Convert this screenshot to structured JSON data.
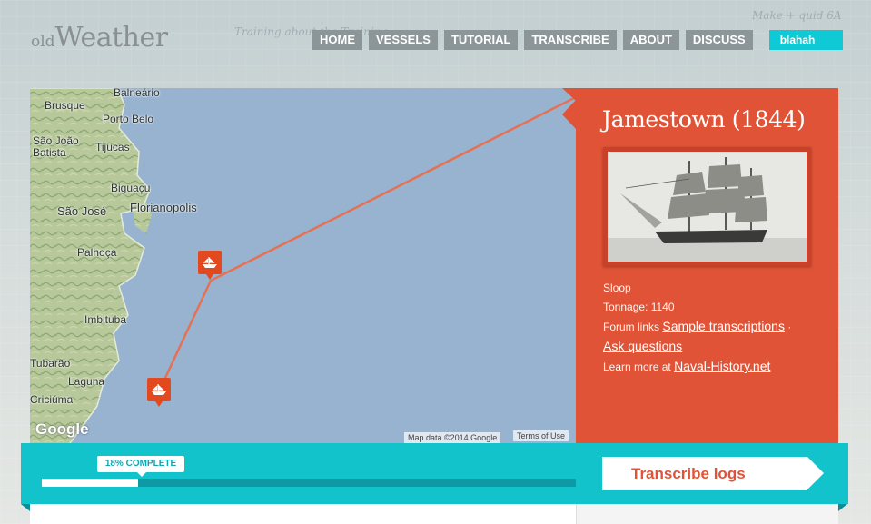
{
  "header": {
    "logo_small": "old",
    "logo_big": "Weather",
    "nav": [
      "HOME",
      "VESSELS",
      "TUTORIAL",
      "TRANSCRIBE",
      "ABOUT",
      "DISCUSS"
    ],
    "user": "blahah"
  },
  "map": {
    "labels": [
      "Balneário",
      "Brusque",
      "Porto Belo",
      "São João Batista",
      "Tijucas",
      "Biguaçu",
      "São José",
      "Florianopolis",
      "Palhoça",
      "Imbituba",
      "Tubarão",
      "Laguna",
      "Criciúma"
    ],
    "logo": "Google",
    "attribution": "Map data ©2014 Google",
    "terms": "Terms of Use"
  },
  "ship": {
    "name": "Jamestown (1844)",
    "type": "Sloop",
    "tonnage_label": "Tonnage: 1140",
    "forum_prefix": "Forum links",
    "forum_link_1": "Sample transcriptions",
    "separator": "·",
    "forum_link_2": "Ask questions",
    "learn_prefix": "Learn more at",
    "learn_link": "Naval-History.net"
  },
  "progress": {
    "percent": 18,
    "label": "18% COMPLETE",
    "cta": "Transcribe logs"
  },
  "colors": {
    "accent_red": "#e05336",
    "accent_teal": "#13c3cc",
    "nav_grey": "#8c9597"
  }
}
